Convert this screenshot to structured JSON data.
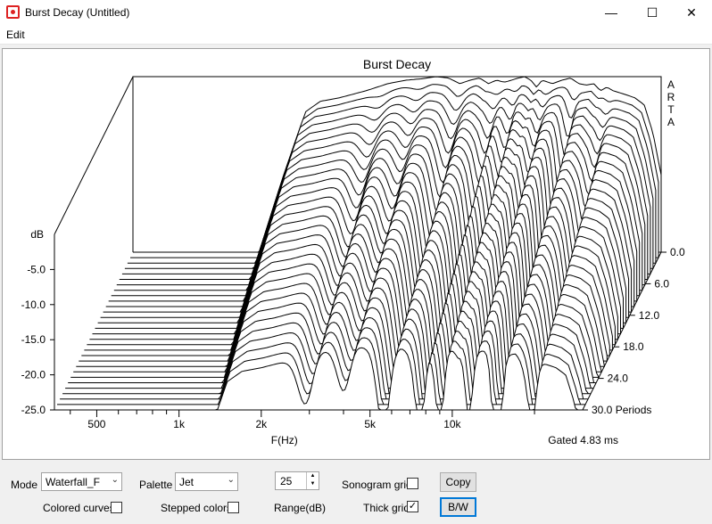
{
  "window": {
    "title": "Burst Decay  (Untitled)",
    "minimize_glyph": "—",
    "maximize_glyph": "☐",
    "close_glyph": "✕"
  },
  "menu": {
    "edit": "Edit"
  },
  "controls": {
    "mode_label": "Mode",
    "mode_value": "Waterfall_F",
    "palette_label": "Palette",
    "palette_value": "Jet",
    "range_value": "25",
    "range_label": "Range(dB)",
    "sonogram_grid_label": "Sonogram grid",
    "sonogram_grid_checked": false,
    "colored_curves_label": "Colored curves",
    "colored_curves_checked": false,
    "stepped_colors_label": "Stepped colors",
    "stepped_colors_checked": false,
    "thick_grid_label": "Thick grid",
    "thick_grid_checked": true,
    "copy_label": "Copy",
    "bw_label": "B/W"
  },
  "chart_data": {
    "type": "waterfall",
    "title": "Burst Decay",
    "watermark": [
      "A",
      "R",
      "T",
      "A"
    ],
    "xlabel": "F(Hz)",
    "x_scale": "log",
    "xlim": [
      350,
      30000
    ],
    "x_tick_labels": [
      {
        "label": "500",
        "value": 500
      },
      {
        "label": "1k",
        "value": 1000
      },
      {
        "label": "2k",
        "value": 2000
      },
      {
        "label": "5k",
        "value": 5000
      },
      {
        "label": "10k",
        "value": 10000
      }
    ],
    "ylabel": "dB",
    "ylim": [
      -25,
      0
    ],
    "y_tick_labels": [
      "-5.0",
      "-10.0",
      "-15.0",
      "-20.0",
      "-25.0"
    ],
    "y_tick_values": [
      -5,
      -10,
      -15,
      -20,
      -25
    ],
    "z_label": "Periods",
    "zlim": [
      0,
      30
    ],
    "z_tick_labels": [
      "0.0",
      "6.0",
      "12.0",
      "18.0",
      "24.0",
      "30.0"
    ],
    "z_tick_values": [
      0,
      6,
      12,
      18,
      24,
      30
    ],
    "gated_text": "Gated 4.83 ms",
    "freq_hz": [
      350,
      1000,
      1300,
      1500,
      1700,
      2000,
      2500,
      3000,
      3500,
      4000,
      4500,
      5000,
      5500,
      6000,
      6500,
      7000,
      7500,
      8000,
      8500,
      9000,
      9500,
      10000,
      10500,
      11000,
      12000,
      13000,
      14000,
      15000,
      16000,
      17000,
      18000,
      19000,
      20000,
      22000,
      24000,
      26000,
      28000,
      30000
    ],
    "initial_response_db": [
      -26,
      -26,
      -12,
      -5,
      -3.5,
      -3,
      -2,
      -1,
      -0.5,
      -0.3,
      0,
      -0.2,
      -1,
      -0.5,
      -0.2,
      -1,
      -0.5,
      -0.8,
      -0.5,
      -0.2,
      0,
      -0.5,
      -1.5,
      -0.5,
      -1,
      -0.5,
      -0.2,
      -1,
      -1.2,
      -1,
      -2,
      -1.5,
      -2,
      -2.5,
      -3,
      -4,
      -8,
      -14
    ],
    "decay_notches": [
      {
        "freq_hz": 2900,
        "width_hz": 250,
        "depth_db": 7
      },
      {
        "freq_hz": 4000,
        "width_hz": 300,
        "depth_db": 6
      },
      {
        "freq_hz": 5600,
        "width_hz": 400,
        "depth_db": 11
      },
      {
        "freq_hz": 7600,
        "width_hz": 400,
        "depth_db": 12
      },
      {
        "freq_hz": 9000,
        "width_hz": 450,
        "depth_db": 11
      },
      {
        "freq_hz": 11500,
        "width_hz": 500,
        "depth_db": 9
      },
      {
        "freq_hz": 14600,
        "width_hz": 700,
        "depth_db": 20
      },
      {
        "freq_hz": 19500,
        "width_hz": 1000,
        "depth_db": 9
      }
    ],
    "slice_count": 30,
    "slice_period_step": 1.0
  }
}
